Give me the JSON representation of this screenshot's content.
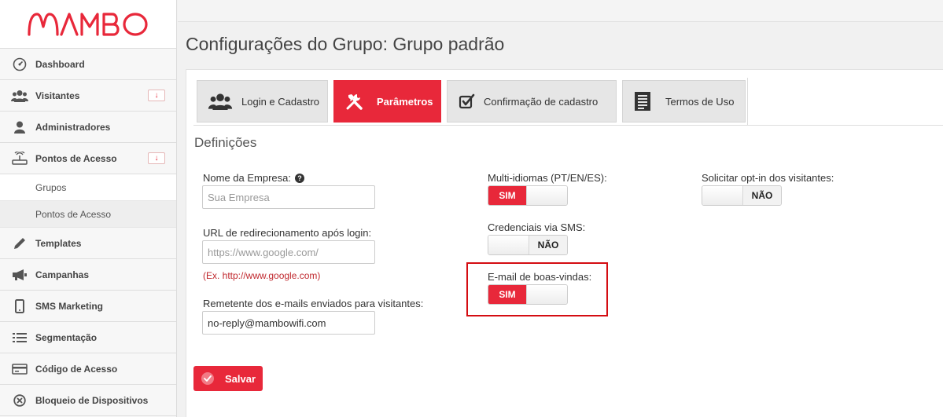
{
  "brand": {
    "logo_text": "MAMBO",
    "accent": "#e8283a"
  },
  "sidebar": {
    "items": [
      {
        "label": "Dashboard",
        "icon": "dashboard-icon"
      },
      {
        "label": "Visitantes",
        "icon": "users-icon",
        "badge": "↓"
      },
      {
        "label": "Administradores",
        "icon": "user-icon"
      },
      {
        "label": "Pontos de Acesso",
        "icon": "router-icon",
        "badge": "↓"
      },
      {
        "label": "Templates",
        "icon": "pencil-icon"
      },
      {
        "label": "Campanhas",
        "icon": "megaphone-icon"
      },
      {
        "label": "SMS Marketing",
        "icon": "phone-icon"
      },
      {
        "label": "Segmentação",
        "icon": "list-icon"
      },
      {
        "label": "Código de Acesso",
        "icon": "card-icon"
      },
      {
        "label": "Bloqueio de Dispositivos",
        "icon": "block-icon"
      }
    ],
    "subitems": [
      {
        "label": "Grupos"
      },
      {
        "label": "Pontos de Acesso"
      }
    ]
  },
  "page": {
    "title": "Configurações do Grupo: Grupo padrão"
  },
  "tabs": [
    {
      "label": "Login e Cadastro",
      "icon": "users-icon"
    },
    {
      "label": "Parâmetros",
      "icon": "tools-icon"
    },
    {
      "label": "Confirmação de cadastro",
      "icon": "checkbox-icon"
    },
    {
      "label": "Termos de Uso",
      "icon": "document-icon"
    }
  ],
  "section": {
    "title": "Definições"
  },
  "form": {
    "company_name": {
      "label": "Nome da Empresa:",
      "help": "?",
      "value": "",
      "placeholder": "Sua Empresa"
    },
    "redirect_url": {
      "label": "URL de redirecionamento após login:",
      "value": "",
      "placeholder": "https://www.google.com/",
      "hint": "(Ex. http://www.google.com)"
    },
    "sender_email": {
      "label": "Remetente dos e-mails enviados para visitantes:",
      "value": "no-reply@mambowifi.com"
    },
    "multi_language": {
      "label": "Multi-idiomas (PT/EN/ES):",
      "state": "SIM"
    },
    "sms_credentials": {
      "label": "Credenciais via SMS:",
      "state": "NÃO"
    },
    "welcome_email": {
      "label": "E-mail de boas-vindas:",
      "state": "SIM"
    },
    "opt_in": {
      "label": "Solicitar opt-in dos visitantes:",
      "state": "NÃO"
    }
  },
  "actions": {
    "save_label": "Salvar"
  }
}
